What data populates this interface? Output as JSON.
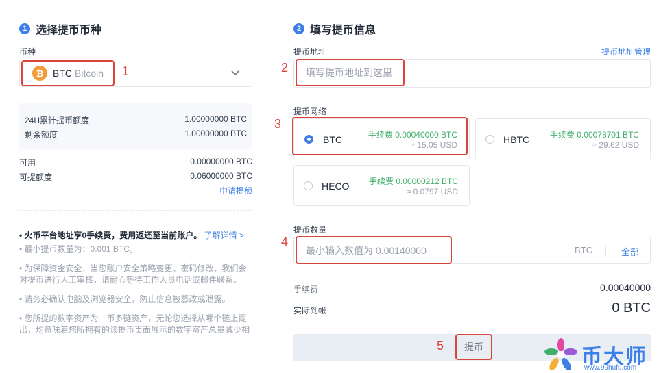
{
  "left": {
    "step": "1",
    "title": "选择提币币种",
    "coin_label": "币种",
    "coin_symbol": "BTC",
    "coin_name": "Bitcoin",
    "coin_icon": "bitcoin-icon",
    "quota": {
      "daily_label": "24H累计提币额度",
      "daily_value": "1.00000000 BTC",
      "remain_label": "剩余额度",
      "remain_value": "1.00000000 BTC"
    },
    "available_label": "可用",
    "available_value": "0.00000000 BTC",
    "withdrawable_label": "可提额度",
    "withdrawable_value": "0.06000000 BTC",
    "apply_link": "申请提额",
    "notes": {
      "n1_bold": "• 火币平台地址享0手续费，费用返还至当前账户。",
      "n1_link": "了解详情 >",
      "n2": "• 最小提币数量为：0.001 BTC。",
      "n3a": "• 为保障资金安全，当您账户安全策略变更、密码修改、我们会",
      "n3b": "对提币进行人工审核，请耐心等待工作人员电话或邮件联系。",
      "n4": "• 请务必确认电脑及浏览器安全，防止信息被篡改或泄露。",
      "n5a": "• 您所提的数字资产为一币多链资产，无论您选择从哪个链上提",
      "n5b": "出，均意味着您所拥有的该提币页面展示的数字资产总量减少相"
    }
  },
  "right": {
    "step": "2",
    "title": "填写提币信息",
    "address_label": "提币地址",
    "address_manage": "提币地址管理",
    "address_placeholder": "填写提币地址到这里",
    "network_label": "提币网络",
    "networks": [
      {
        "name": "BTC",
        "fee": "手续费 0.00040000 BTC",
        "usd": "≈ 15.05 USD",
        "selected": true
      },
      {
        "name": "HBTC",
        "fee": "手续费 0.00078701 BTC",
        "usd": "≈ 29.62 USD",
        "selected": false
      },
      {
        "name": "HECO",
        "fee": "手续费 0.00000212 BTC",
        "usd": "≈ 0.0797 USD",
        "selected": false
      }
    ],
    "amount_label": "提币数量",
    "amount_placeholder": "最小输入数值为 0.00140000",
    "amount_unit": "BTC",
    "amount_all": "全部",
    "fee_label": "手续费",
    "fee_value": "0.00040000",
    "received_label": "实际到帐",
    "received_value": "0 BTC",
    "submit": "提币"
  },
  "annotations": [
    "1",
    "2",
    "3",
    "4",
    "5"
  ],
  "watermark": {
    "text": "币大师",
    "url": "www.99hufu.com"
  },
  "colors": {
    "accent": "#3d7fe6",
    "annotation_red": "#d9453a",
    "fee_green": "#3fae6b",
    "bitcoin_orange": "#f29b38"
  }
}
